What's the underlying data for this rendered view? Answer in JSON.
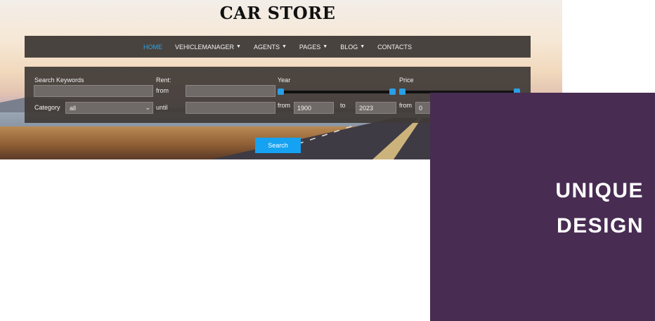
{
  "store_title": "CAR STORE",
  "nav": {
    "items": [
      {
        "label": "HOME",
        "active": true,
        "dropdown": false
      },
      {
        "label": "VEHICLEMANAGER",
        "active": false,
        "dropdown": true
      },
      {
        "label": "AGENTS",
        "active": false,
        "dropdown": true
      },
      {
        "label": "PAGES",
        "active": false,
        "dropdown": true
      },
      {
        "label": "BLOG",
        "active": false,
        "dropdown": true
      },
      {
        "label": "CONTACTS",
        "active": false,
        "dropdown": false
      }
    ],
    "caret": "▼"
  },
  "search": {
    "keywords_label": "Search Keywords",
    "keywords_value": "",
    "category_label": "Category",
    "category_value": "all",
    "rent_label": "Rent:",
    "from_label": "from",
    "until_label": "until",
    "rent_from_value": "",
    "rent_until_value": "",
    "year_label": "Year",
    "year_from_label": "from",
    "year_from_value": "1900",
    "year_to_label": "to",
    "year_to_value": "2023",
    "price_label": "Price",
    "price_from_label": "from",
    "price_from_value": "0",
    "button_label": "Search"
  },
  "promo": {
    "line1": "UNIQUE",
    "line2": "DESIGN"
  },
  "colors": {
    "accent": "#15a2f2",
    "nav_active": "#2aa6e8",
    "promo_bg": "#482c52"
  }
}
